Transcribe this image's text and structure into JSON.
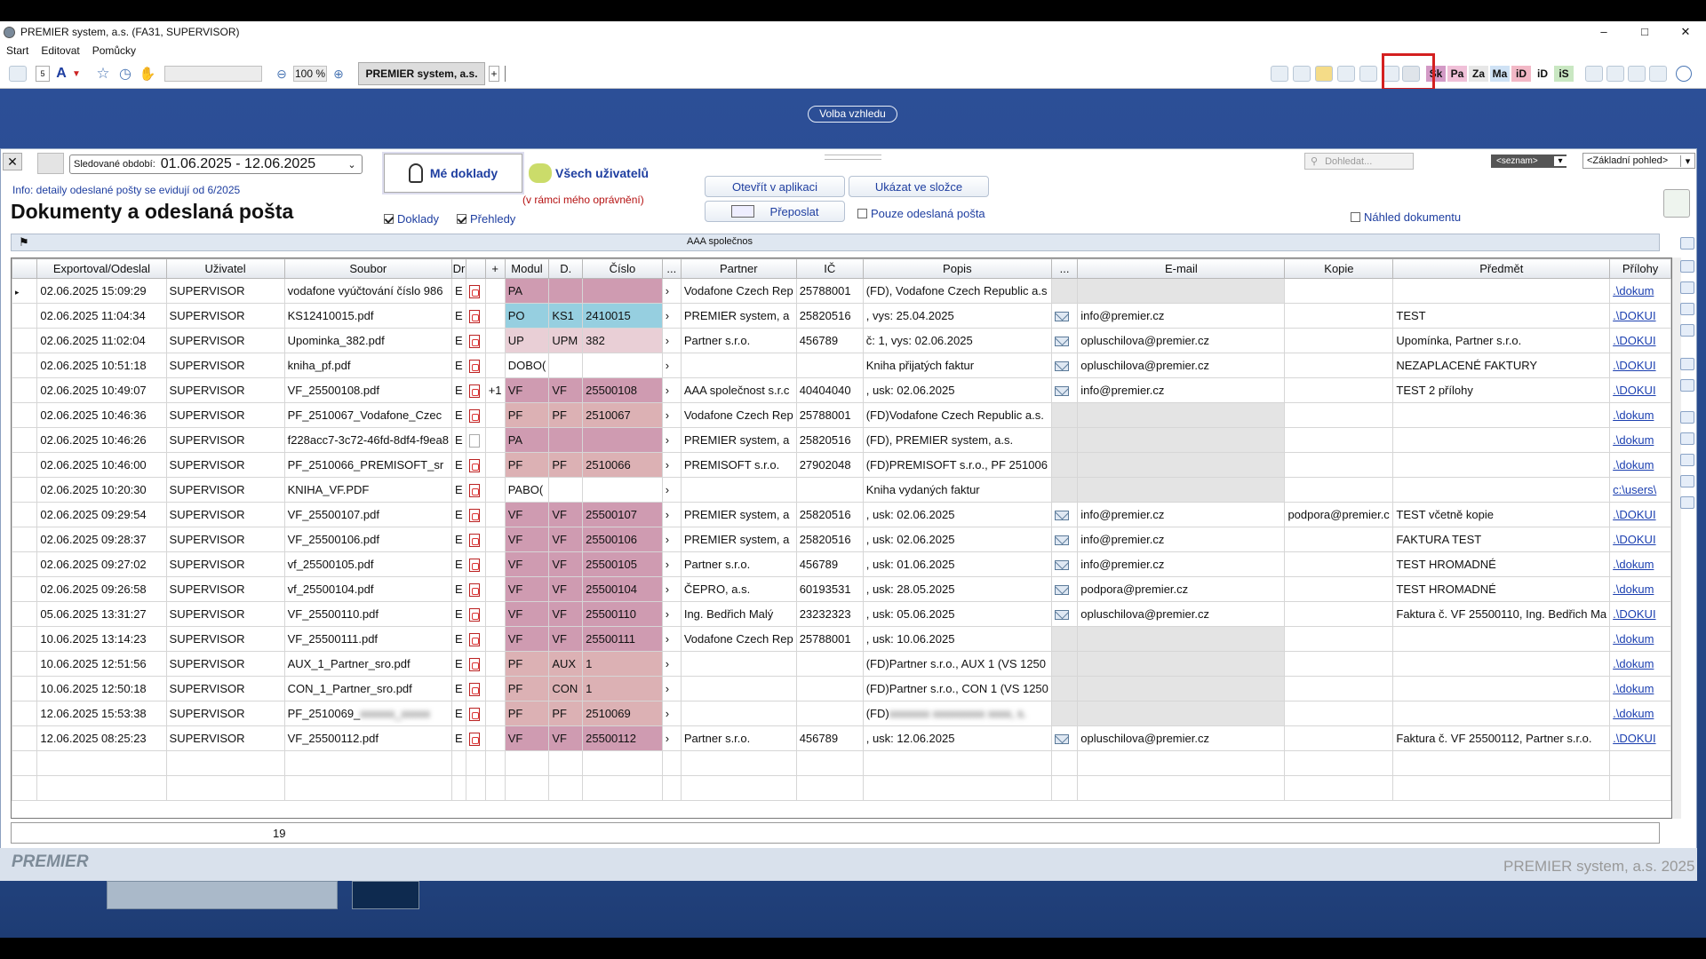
{
  "window": {
    "title": "PREMIER system, a.s. (FA31, SUPERVISOR)",
    "minimize": "–",
    "maximize": "□",
    "close": "✕"
  },
  "menu": [
    "Start",
    "Editovat",
    "Pomůcky"
  ],
  "toolbar": {
    "zoom": "100 %",
    "tab": "PREMIER system, a.s.",
    "plus": "+",
    "font_size": "5",
    "chips": [
      "Sk",
      "Pa",
      "Za",
      "Ma",
      "iD",
      "iD",
      "iS"
    ],
    "chip_colors": [
      "#d39ac6",
      "#f0c0d8",
      "#e7e7e7",
      "#cfe2f5",
      "#f2b8c6",
      "#ffffff",
      "#c9e7c2"
    ]
  },
  "volba": "Volba vzhledu",
  "filter": {
    "period_label": "Sledované období:",
    "period_value": "01.06.2025  - 12.06.2025"
  },
  "info": "Info: detaily odeslané pošty se evidují od 6/2025",
  "heading": "Dokumenty a odeslaná pošta",
  "me_button": "Mé doklady",
  "all_button": "Všech uživatelů",
  "permission": "(v rámci mého oprávnění)",
  "cb_doklady": "Doklady",
  "cb_prehledy": "Přehledy",
  "btn_open": "Otevřít v aplikaci",
  "btn_show": "Ukázat ve složce",
  "btn_forward": "Přeposlat",
  "cb_sent": "Pouze odeslaná pošta",
  "cb_preview": "Náhled dokumentu",
  "search_placeholder": "Dohledat...",
  "list_select": "<seznam>",
  "view_select": "<Základní pohled>",
  "filter_partner": "AAA společnos",
  "columns": [
    "",
    "Exportoval/Odeslal",
    "Uživatel",
    "Soubor",
    "Dr",
    "",
    "+",
    "Modul",
    "D.",
    "Číslo",
    "...",
    "Partner",
    "IČ",
    "Popis",
    "...",
    "E-mail",
    "Kopie",
    "Předmět",
    "Přílohy"
  ],
  "rows": [
    {
      "date": "02.06.2025 15:09:29",
      "user": "SUPERVISOR",
      "file": "vodafone vyúčtování číslo 986",
      "dr": "E",
      "icon": "pdf",
      "plus": "",
      "mod": "PA",
      "d": "",
      "num": "",
      "partner": "Vodafone Czech Rep",
      "ic": "25788001",
      "popis": "(FD), Vodafone Czech Republic a.s",
      "env": "",
      "email": "",
      "kopie": "",
      "predmet": "",
      "prilohy": ".\\dokum",
      "ms": "m",
      "grey": "g"
    },
    {
      "date": "02.06.2025 11:04:34",
      "user": "SUPERVISOR",
      "file": "KS12410015.pdf",
      "dr": "E",
      "icon": "pdf",
      "plus": "",
      "mod": "PO",
      "d": "KS1",
      "num": "2410015",
      "partner": "PREMIER system, a",
      "ic": "25820516",
      "popis": ", vys: 25.04.2025",
      "env": "y",
      "email": "info@premier.cz",
      "kopie": "",
      "predmet": "TEST",
      "prilohy": ".\\DOKUI",
      "ms": "mpo",
      "grey": ""
    },
    {
      "date": "02.06.2025 11:02:04",
      "user": "SUPERVISOR",
      "file": "Upominka_382.pdf",
      "dr": "E",
      "icon": "pdf",
      "plus": "",
      "mod": "UP",
      "d": "UPM",
      "num": "382",
      "partner": "Partner s.r.o.",
      "ic": "456789",
      "popis": "č: 1, vys: 02.06.2025",
      "env": "y",
      "email": "opluschilova@premier.cz",
      "kopie": "",
      "predmet": "Upomínka, Partner s.r.o.",
      "prilohy": ".\\DOKUI",
      "ms": "mup",
      "grey": ""
    },
    {
      "date": "02.06.2025 10:51:18",
      "user": "SUPERVISOR",
      "file": "kniha_pf.pdf",
      "dr": "E",
      "icon": "pdf",
      "plus": "",
      "mod": "DOBO(",
      "d": "",
      "num": "",
      "partner": "",
      "ic": "",
      "popis": "Kniha přijatých faktur",
      "env": "y",
      "email": "opluschilova@premier.cz",
      "kopie": "",
      "predmet": "NEZAPLACENÉ FAKTURY",
      "prilohy": ".\\DOKUI",
      "ms": "",
      "grey": ""
    },
    {
      "date": "02.06.2025 10:49:07",
      "user": "SUPERVISOR",
      "file": "VF_25500108.pdf",
      "dr": "E",
      "icon": "pdf",
      "plus": "+1",
      "mod": "VF",
      "d": "VF",
      "num": "25500108",
      "partner": "AAA společnost s.r.c",
      "ic": "40404040",
      "popis": ", usk: 02.06.2025",
      "env": "y",
      "email": "info@premier.cz",
      "kopie": "",
      "predmet": "TEST 2 přílohy",
      "prilohy": ".\\DOKUI",
      "ms": "m",
      "grey": ""
    },
    {
      "date": "02.06.2025 10:46:36",
      "user": "SUPERVISOR",
      "file": "PF_2510067_Vodafone_Czec",
      "dr": "E",
      "icon": "pdf",
      "plus": "",
      "mod": "PF",
      "d": "PF",
      "num": "2510067",
      "partner": "Vodafone Czech Rep",
      "ic": "25788001",
      "popis": "(FD)Vodafone Czech Republic a.s.",
      "env": "",
      "email": "",
      "kopie": "",
      "predmet": "",
      "prilohy": ".\\dokum",
      "ms": "m2",
      "grey": "g"
    },
    {
      "date": "02.06.2025 10:46:26",
      "user": "SUPERVISOR",
      "file": "f228acc7-3c72-46fd-8df4-f9ea8",
      "dr": "E",
      "icon": "blank",
      "plus": "",
      "mod": "PA",
      "d": "",
      "num": "",
      "partner": "PREMIER system, a",
      "ic": "25820516",
      "popis": "(FD), PREMIER system, a.s.",
      "env": "",
      "email": "",
      "kopie": "",
      "predmet": "",
      "prilohy": ".\\dokum",
      "ms": "m",
      "grey": "g"
    },
    {
      "date": "02.06.2025 10:46:00",
      "user": "SUPERVISOR",
      "file": "PF_2510066_PREMISOFT_sr",
      "dr": "E",
      "icon": "pdf",
      "plus": "",
      "mod": "PF",
      "d": "PF",
      "num": "2510066",
      "partner": "PREMISOFT s.r.o.",
      "ic": "27902048",
      "popis": "(FD)PREMISOFT s.r.o., PF  251006",
      "env": "",
      "email": "",
      "kopie": "",
      "predmet": "",
      "prilohy": ".\\dokum",
      "ms": "m2",
      "grey": "g"
    },
    {
      "date": "02.06.2025 10:20:30",
      "user": "SUPERVISOR",
      "file": "KNIHA_VF.PDF",
      "dr": "E",
      "icon": "pdf",
      "plus": "",
      "mod": "PABO(",
      "d": "",
      "num": "",
      "partner": "",
      "ic": "",
      "popis": "Kniha vydaných faktur",
      "env": "",
      "email": "",
      "kopie": "",
      "predmet": "",
      "prilohy": "c:\\users\\",
      "ms": "",
      "grey": "g"
    },
    {
      "date": "02.06.2025 09:29:54",
      "user": "SUPERVISOR",
      "file": "VF_25500107.pdf",
      "dr": "E",
      "icon": "pdf",
      "plus": "",
      "mod": "VF",
      "d": "VF",
      "num": "25500107",
      "partner": "PREMIER system, a",
      "ic": "25820516",
      "popis": ", usk: 02.06.2025",
      "env": "y",
      "email": "info@premier.cz",
      "kopie": "podpora@premier.c",
      "predmet": "TEST včetně kopie",
      "prilohy": ".\\DOKUI",
      "ms": "m",
      "grey": ""
    },
    {
      "date": "02.06.2025 09:28:37",
      "user": "SUPERVISOR",
      "file": "VF_25500106.pdf",
      "dr": "E",
      "icon": "pdf",
      "plus": "",
      "mod": "VF",
      "d": "VF",
      "num": "25500106",
      "partner": "PREMIER system, a",
      "ic": "25820516",
      "popis": ", usk: 02.06.2025",
      "env": "y",
      "email": "info@premier.cz",
      "kopie": "",
      "predmet": "FAKTURA TEST",
      "prilohy": ".\\DOKUI",
      "ms": "m",
      "grey": ""
    },
    {
      "date": "02.06.2025 09:27:02",
      "user": "SUPERVISOR",
      "file": "vf_25500105.pdf",
      "dr": "E",
      "icon": "pdf",
      "plus": "",
      "mod": "VF",
      "d": "VF",
      "num": "25500105",
      "partner": "Partner s.r.o.",
      "ic": "456789",
      "popis": ", usk: 01.06.2025",
      "env": "y",
      "email": "info@premier.cz",
      "kopie": "",
      "predmet": "TEST HROMADNÉ",
      "prilohy": ".\\dokum",
      "ms": "m",
      "grey": ""
    },
    {
      "date": "02.06.2025 09:26:58",
      "user": "SUPERVISOR",
      "file": "vf_25500104.pdf",
      "dr": "E",
      "icon": "pdf",
      "plus": "",
      "mod": "VF",
      "d": "VF",
      "num": "25500104",
      "partner": "ČEPRO, a.s.",
      "ic": "60193531",
      "popis": ", usk: 28.05.2025",
      "env": "y",
      "email": "podpora@premier.cz",
      "kopie": "",
      "predmet": "TEST HROMADNÉ",
      "prilohy": ".\\dokum",
      "ms": "m",
      "grey": ""
    },
    {
      "date": "05.06.2025 13:31:27",
      "user": "SUPERVISOR",
      "file": "VF_25500110.pdf",
      "dr": "E",
      "icon": "pdf",
      "plus": "",
      "mod": "VF",
      "d": "VF",
      "num": "25500110",
      "partner": "Ing. Bedřich Malý",
      "ic": "23232323",
      "popis": ", usk: 05.06.2025",
      "env": "y",
      "email": "opluschilova@premier.cz",
      "kopie": "",
      "predmet": "Faktura č. VF  25500110, Ing. Bedřich Ma",
      "prilohy": ".\\DOKUI",
      "ms": "m",
      "grey": ""
    },
    {
      "date": "10.06.2025 13:14:23",
      "user": "SUPERVISOR",
      "file": "VF_25500111.pdf",
      "dr": "E",
      "icon": "pdf",
      "plus": "",
      "mod": "VF",
      "d": "VF",
      "num": "25500111",
      "partner": "Vodafone Czech Rep",
      "ic": "25788001",
      "popis": ", usk: 10.06.2025",
      "env": "",
      "email": "",
      "kopie": "",
      "predmet": "",
      "prilohy": ".\\dokum",
      "ms": "m",
      "grey": "g"
    },
    {
      "date": "10.06.2025 12:51:56",
      "user": "SUPERVISOR",
      "file": "AUX_1_Partner_sro.pdf",
      "dr": "E",
      "icon": "pdf",
      "plus": "",
      "mod": "PF",
      "d": "AUX",
      "num": "1",
      "partner": "",
      "ic": "",
      "popis": "(FD)Partner s.r.o., AUX 1  (VS 1250",
      "env": "",
      "email": "",
      "kopie": "",
      "predmet": "",
      "prilohy": ".\\dokum",
      "ms": "m2",
      "grey": "g"
    },
    {
      "date": "10.06.2025 12:50:18",
      "user": "SUPERVISOR",
      "file": "CON_1_Partner_sro.pdf",
      "dr": "E",
      "icon": "pdf",
      "plus": "",
      "mod": "PF",
      "d": "CON",
      "num": "1",
      "partner": "",
      "ic": "",
      "popis": "(FD)Partner s.r.o., CON 1  (VS 1250",
      "env": "",
      "email": "",
      "kopie": "",
      "predmet": "",
      "prilohy": ".\\dokum",
      "ms": "m2",
      "grey": "g"
    },
    {
      "date": "12.06.2025 15:53:38",
      "user": "SUPERVISOR",
      "file": "PF_2510069_",
      "dr": "E",
      "icon": "pdf",
      "plus": "",
      "mod": "PF",
      "d": "PF",
      "num": "2510069",
      "partner": "",
      "ic": "",
      "popis": "(FD)",
      "env": "",
      "email": "",
      "kopie": "",
      "predmet": "",
      "prilohy": ".\\dokum",
      "ms": "m2",
      "grey": "g",
      "blurred": "y"
    },
    {
      "date": "12.06.2025 08:25:23",
      "user": "SUPERVISOR",
      "file": "VF_25500112.pdf",
      "dr": "E",
      "icon": "pdf",
      "plus": "",
      "mod": "VF",
      "d": "VF",
      "num": "25500112",
      "partner": "Partner s.r.o.",
      "ic": "456789",
      "popis": ", usk: 12.06.2025",
      "env": "y",
      "email": "opluschilova@premier.cz",
      "kopie": "",
      "predmet": "Faktura č. VF  25500112, Partner s.r.o.",
      "prilohy": ".\\DOKUI",
      "ms": "m",
      "grey": ""
    }
  ],
  "footer": {
    "count": "19"
  },
  "logo": "PREMIER",
  "copyright": "PREMIER system, a.s.   2025"
}
